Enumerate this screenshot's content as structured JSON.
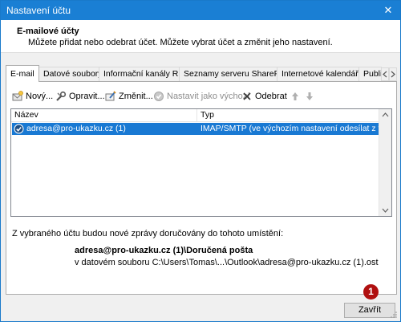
{
  "window": {
    "title": "Nastavení účtu",
    "close_glyph": "✕"
  },
  "header": {
    "title": "E-mailové účty",
    "description": "Můžete přidat nebo odebrat účet. Můžete vybrat účet a změnit jeho nastavení."
  },
  "tabs": [
    {
      "label": "E-mail",
      "active": true
    },
    {
      "label": "Datové soubory",
      "active": false
    },
    {
      "label": "Informační kanály RSS",
      "active": false
    },
    {
      "label": "Seznamy serveru SharePoint",
      "active": false
    },
    {
      "label": "Internetové kalendáře",
      "active": false
    },
    {
      "label": "Publi",
      "active": false
    }
  ],
  "toolbar": {
    "new_label": "Nový...",
    "repair_label": "Opravit...",
    "change_label": "Změnit...",
    "set_default_label": "Nastavit jako výchozí",
    "remove_label": "Odebrat"
  },
  "accounts_table": {
    "headers": [
      "Název",
      "Typ"
    ],
    "rows": [
      {
        "name": "adresa@pro-ukazku.cz (1)",
        "type": "IMAP/SMTP (ve výchozím nastavení odesílat z tohot..."
      }
    ]
  },
  "delivery": {
    "label": "Z vybraného účtu budou nové zprávy doručovány do tohoto umístění:",
    "folder": "adresa@pro-ukazku.cz (1)\\Doručená pošta",
    "path": "v datovém souboru C:\\Users\\Tomas\\...\\Outlook\\adresa@pro-ukazku.cz (1).ost"
  },
  "footer": {
    "close_label": "Zavřít",
    "callout_number": "1"
  },
  "colors": {
    "titlebar": "#1a7fd4",
    "selection": "#1979d3",
    "callout": "#b01010"
  }
}
